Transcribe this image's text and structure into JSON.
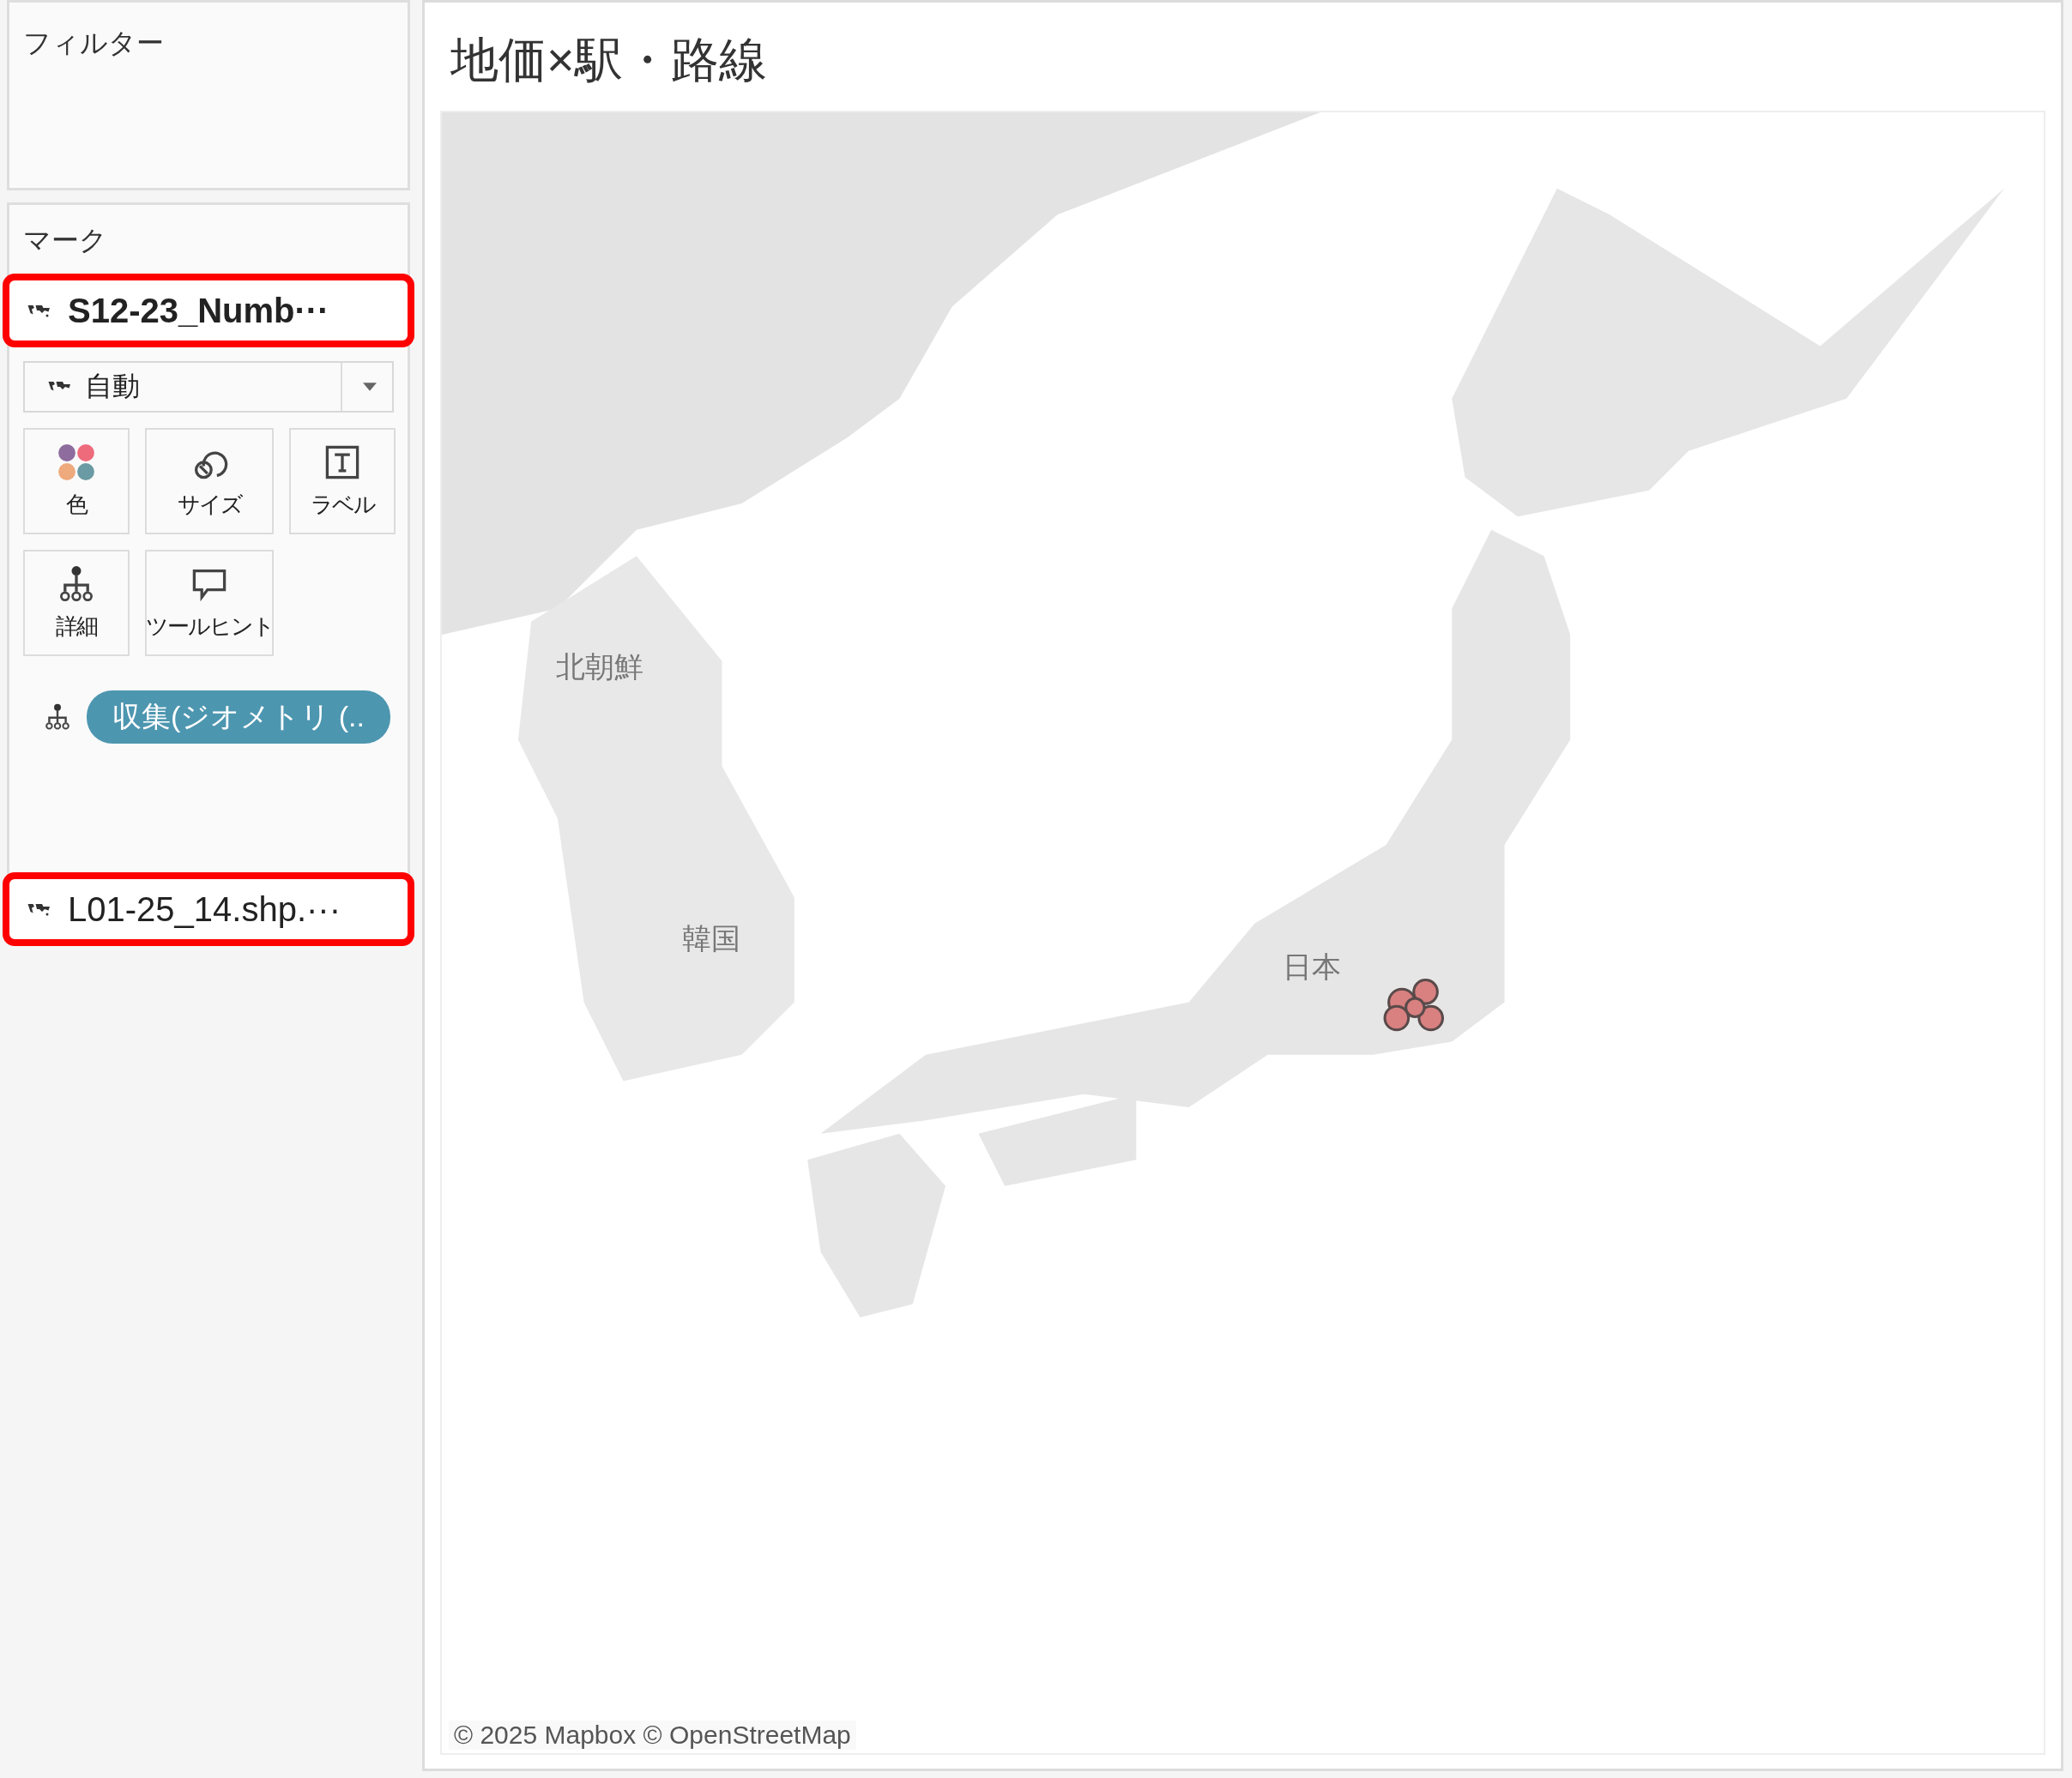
{
  "filters": {
    "title": "フィルター"
  },
  "marks": {
    "title": "マーク",
    "layers": [
      {
        "name": "S12-23_Numb···",
        "expanded": true,
        "highlighted": true,
        "mark_type": "自動",
        "cards": [
          {
            "kind": "color",
            "label": "色"
          },
          {
            "kind": "size",
            "label": "サイズ"
          },
          {
            "kind": "label",
            "label": "ラベル"
          },
          {
            "kind": "detail",
            "label": "詳細"
          },
          {
            "kind": "tooltip",
            "label": "ツールヒント"
          }
        ],
        "fields": [
          {
            "kind": "detail",
            "label": "収集(ジオメトリ (.."
          }
        ]
      },
      {
        "name": "L01-25_14.shp.···",
        "expanded": false,
        "highlighted": true
      }
    ]
  },
  "sheet": {
    "title": "地価×駅・路線",
    "map": {
      "labels": [
        {
          "text": "北朝鮮"
        },
        {
          "text": "韓国"
        },
        {
          "text": "日本"
        }
      ],
      "credit": "© 2025 Mapbox © OpenStreetMap"
    }
  }
}
